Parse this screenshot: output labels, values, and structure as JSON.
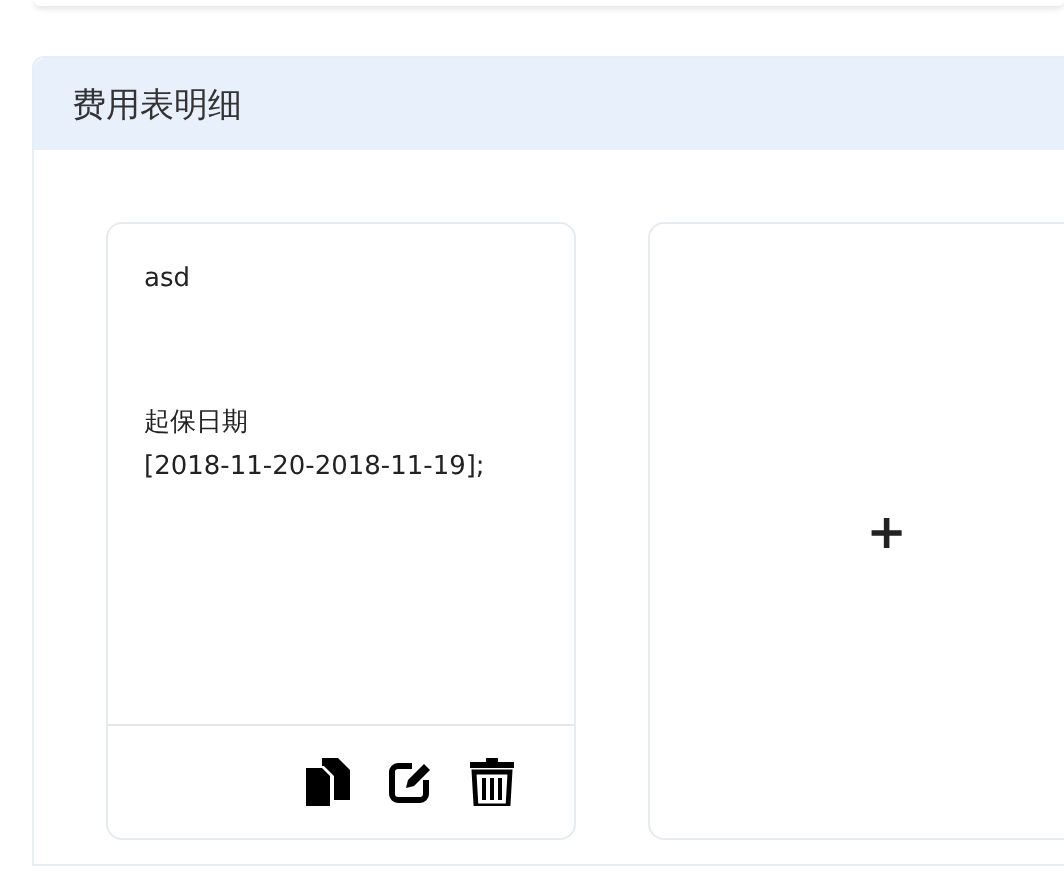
{
  "section": {
    "title": "费用表明细"
  },
  "cards": [
    {
      "kind": "entry",
      "name": "asd",
      "label": "起保日期",
      "value": "[2018-11-20-2018-11-19];",
      "actions": [
        {
          "kind": "copy"
        },
        {
          "kind": "edit"
        },
        {
          "kind": "delete"
        }
      ]
    },
    {
      "kind": "add",
      "symbol": "+"
    }
  ]
}
